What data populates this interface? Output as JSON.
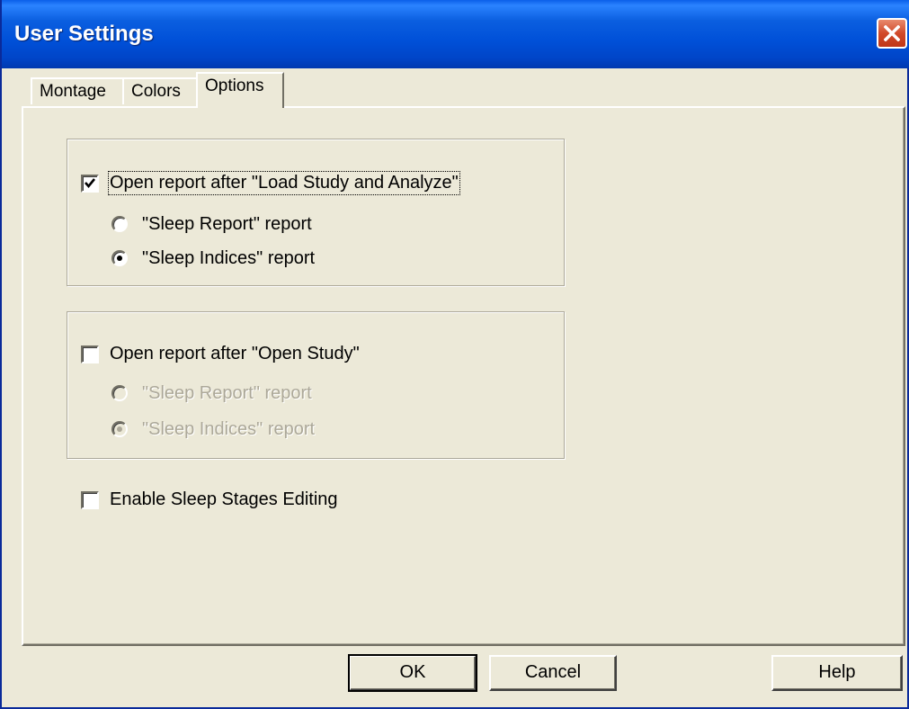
{
  "window": {
    "title": "User Settings"
  },
  "tabs": [
    {
      "label": "Montage"
    },
    {
      "label": "Colors"
    },
    {
      "label": "Options",
      "active": true
    }
  ],
  "options": {
    "group1": {
      "checkbox_label": "Open report after  \"Load Study and Analyze\"",
      "checked": true,
      "radio1_label": "\"Sleep Report\" report",
      "radio2_label": "\"Sleep Indices\" report",
      "selected": 2
    },
    "group2": {
      "checkbox_label": "Open report after  \"Open Study\"",
      "checked": false,
      "radio1_label": "\"Sleep Report\" report",
      "radio2_label": "\"Sleep Indices\" report",
      "selected": 2,
      "disabled": true
    },
    "editing": {
      "checkbox_label": "Enable Sleep Stages Editing",
      "checked": false
    }
  },
  "buttons": {
    "ok": "OK",
    "cancel": "Cancel",
    "help": "Help"
  },
  "icons": {
    "close": "close-icon",
    "check": "checkmark-icon"
  }
}
